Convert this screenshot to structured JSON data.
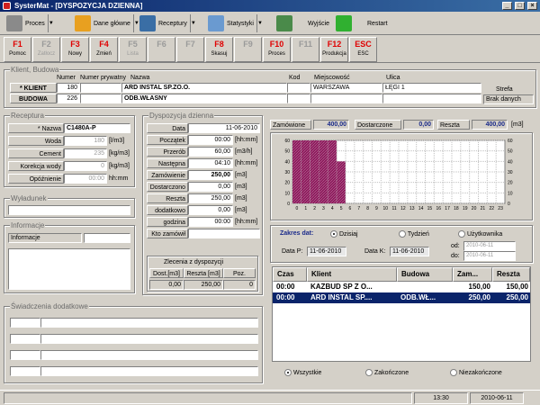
{
  "window": {
    "title": "SysterMat - [DYSPOZYCJA DZIENNA]",
    "minimize": "_",
    "maximize": "□",
    "close": "×"
  },
  "menu": [
    {
      "label": "Proces",
      "color": "#8a8a8a",
      "icon": "process-icon"
    },
    {
      "label": "Dane główne",
      "color": "#e8a020",
      "icon": "folder-icon"
    },
    {
      "label": "Receptury",
      "color": "#3a6ea5",
      "icon": "recipe-icon"
    },
    {
      "label": "Statystyki",
      "color": "#6a9ad0",
      "icon": "statistics-icon"
    },
    {
      "label": "Wyjście",
      "color": "#4a8a4a",
      "icon": "exit-house-icon"
    },
    {
      "label": "Restart",
      "color": "#30b030",
      "icon": "restart-icon"
    }
  ],
  "fkeys": [
    {
      "key": "F1",
      "label": "Pomoc",
      "active": true
    },
    {
      "key": "F2",
      "label": "Zatłocz",
      "active": false
    },
    {
      "key": "F3",
      "label": "Nowy",
      "active": true
    },
    {
      "key": "F4",
      "label": "Zmień",
      "active": true
    },
    {
      "key": "F5",
      "label": "Lista",
      "active": false
    },
    {
      "key": "F6",
      "label": "",
      "active": false
    },
    {
      "key": "F7",
      "label": "",
      "active": false
    },
    {
      "key": "F8",
      "label": "Skasuj",
      "active": true
    },
    {
      "key": "F9",
      "label": "",
      "active": false
    },
    {
      "key": "F10",
      "label": "Proces",
      "active": true
    },
    {
      "key": "F11",
      "label": "",
      "active": false
    },
    {
      "key": "F12",
      "label": "Produkcja",
      "active": true
    },
    {
      "key": "ESC",
      "label": "ESC",
      "active": true
    }
  ],
  "client": {
    "group_title": "Klient, Budowa",
    "headers": {
      "numer": "Numer",
      "numer_prywatny": "Numer prywatny",
      "nazwa": "Nazwa",
      "kod": "Kod",
      "miejscowosc": "Miejscowość",
      "ulica": "Ulica",
      "strefa": "Strefa"
    },
    "klient": {
      "label": "* KLIENT",
      "numer": "180",
      "numer_prywatny": "",
      "nazwa": "ARD INSTAL SP.ZO.O.",
      "kod": "",
      "miejscowosc": "WARSZAWA",
      "ulica": "ŁĘGI 1"
    },
    "budowa": {
      "label": "BUDOWA",
      "numer": "226",
      "numer_prywatny": "",
      "nazwa": "ODB.WŁASNY",
      "kod": "",
      "miejscowosc": "",
      "ulica": ""
    },
    "strefa": "Brak danych"
  },
  "recipe": {
    "group_title": "Receptura",
    "rows": [
      {
        "label": "* Nazwa",
        "value": "C1480A-P",
        "unit": ""
      },
      {
        "label": "Woda",
        "value": "180",
        "unit": "[l/m3]"
      },
      {
        "label": "Cement",
        "value": "235",
        "unit": "[kg/m3]"
      },
      {
        "label": "Korekcja wody",
        "value": "0",
        "unit": "[kg/m3]"
      },
      {
        "label": "Opóźnienie",
        "value": "00:00",
        "unit": "hh:mm"
      }
    ]
  },
  "wyladunek": {
    "group_title": "Wyładunek"
  },
  "informacje": {
    "group_title": "Informacje",
    "label": "Informacje"
  },
  "swiadczenia": {
    "group_title": "Świadczenia dodatkowe"
  },
  "dispatch": {
    "group_title": "Dyspozycja dzienna",
    "rows": [
      {
        "label": "Data",
        "value": "11-06-2010",
        "unit": ""
      },
      {
        "label": "Początek",
        "value": "00:00",
        "unit": "[hh:mm]"
      },
      {
        "label": "Przerób",
        "value": "60,00",
        "unit": "[m3/h]"
      },
      {
        "label": "Następna",
        "value": "04:10",
        "unit": "[hh:mm]"
      },
      {
        "label": "Zamówienie",
        "value": "250,00",
        "unit": "[m3]"
      },
      {
        "label": "Dostarczono",
        "value": "0,00",
        "unit": "[m3]"
      },
      {
        "label": "Reszta",
        "value": "250,00",
        "unit": "[m3]"
      },
      {
        "label": "dodatkowo",
        "value": "0,00",
        "unit": "[m3]"
      },
      {
        "label": "godzina",
        "value": "00:00",
        "unit": "[hh:mm]"
      },
      {
        "label": "Kto zamówił",
        "value": "",
        "unit": ""
      }
    ],
    "zlecenia_title": "Zlecenia z dyspozycji",
    "zlecenia_headers": [
      "Dost.[m3]",
      "Reszta [m3]",
      "Poz."
    ],
    "zlecenia_values": [
      "0,00",
      "250,00",
      "0"
    ]
  },
  "summary": {
    "zamowione_label": "Zamówione",
    "zamowione": "400,00",
    "dostarczone_label": "Dostarczone",
    "dostarczone": "0,00",
    "reszta_label": "Reszta",
    "reszta": "400,00",
    "unit": "[m3]"
  },
  "chart_data": {
    "type": "bar",
    "x": [
      0,
      1,
      2,
      3,
      4,
      5,
      6,
      7,
      8,
      9,
      10,
      11,
      12,
      13,
      14,
      15,
      16,
      17,
      18,
      19,
      20,
      21,
      22,
      23
    ],
    "values": [
      60,
      60,
      60,
      60,
      60,
      40,
      0,
      0,
      0,
      0,
      0,
      0,
      0,
      0,
      0,
      0,
      0,
      0,
      0,
      0,
      0,
      0,
      0,
      0
    ],
    "ylim": [
      0,
      60
    ],
    "yticks": [
      "60",
      "50",
      "40",
      "30",
      "20",
      "10",
      "0"
    ],
    "bar_color": "#8b1a5a",
    "grid": true
  },
  "range": {
    "label": "Zakres dat:",
    "options": [
      "Dzisiaj",
      "Tydzień",
      "Użytkownika"
    ],
    "selected": 0,
    "data_p_label": "Data P:",
    "data_p": "11-06-2010",
    "data_k_label": "Data K:",
    "data_k": "11-06-2010",
    "od_label": "od:",
    "od": "2010-06-11",
    "do_label": "do:",
    "do": "2010-06-11"
  },
  "orders": {
    "headers": [
      "Czas",
      "Klient",
      "Budowa",
      "Zam...",
      "Reszta"
    ],
    "rows": [
      {
        "czas": "00:00",
        "klient": "KAZBUD  SP Z O...",
        "budowa": "",
        "zam": "150,00",
        "reszta": "150,00",
        "selected": false
      },
      {
        "czas": "00:00",
        "klient": "ARD INSTAL SP....",
        "budowa": "ODB.WŁ...",
        "zam": "250,00",
        "reszta": "250,00",
        "selected": true
      }
    ]
  },
  "filter": {
    "options": [
      "Wszystkie",
      "Zakończone",
      "Niezakończone"
    ],
    "selected": 0
  },
  "status": {
    "time": "13:30",
    "date": "2010-06-11"
  }
}
